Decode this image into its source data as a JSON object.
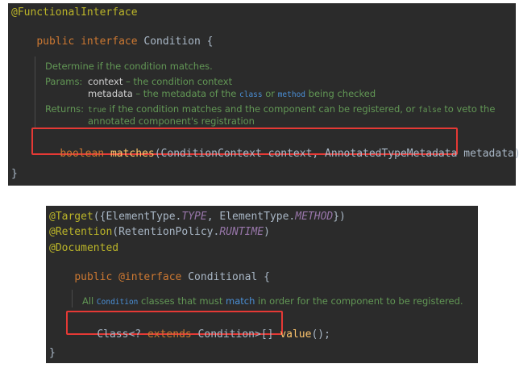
{
  "snippet1": {
    "annotation": "@FunctionalInterface",
    "decl": {
      "kw_public": "public",
      "kw_interface": "interface",
      "name": "Condition",
      "open_brace": "{"
    },
    "doc": {
      "summary": "Determine if the condition matches.",
      "params_label": "Params:",
      "param1_name": "context",
      "param1_desc": " – the condition context",
      "param2_name": "metadata",
      "param2_desc_pre": " – the metadata of the ",
      "param2_code1": "class",
      "param2_mid": " or ",
      "param2_code2": "method",
      "param2_post": " being checked",
      "returns_label": "Returns:",
      "returns_code1": "true",
      "returns_text1": " if the condition matches and the component can be registered, or ",
      "returns_code2": "false",
      "returns_text2": " to veto the",
      "returns_line2": "annotated component's registration"
    },
    "method": {
      "return_type": "boolean",
      "name": "matches",
      "params": "(ConditionContext context, AnnotatedTypeMetadata metadata);"
    },
    "close_brace": "}"
  },
  "snippet2": {
    "target": {
      "ann": "@Target",
      "open": "({ElementType.",
      "type_const": "TYPE",
      "sep": ", ElementType.",
      "method_const": "METHOD",
      "close": "})"
    },
    "retention": {
      "ann": "@Retention",
      "open": "(RetentionPolicy.",
      "const": "RUNTIME",
      "close": ")"
    },
    "documented": "@Documented",
    "decl": {
      "kw_public": "public",
      "kw_interface": "@interface",
      "name": "Conditional",
      "open_brace": "{"
    },
    "doc": {
      "pre": "All ",
      "code": "Condition",
      "mid": " classes that must ",
      "link": "match",
      "post": " in order for the component to be registered."
    },
    "method": {
      "type_pre": "Class<? ",
      "kw_extends": "extends",
      "type_post": " Condition>[] ",
      "name": "value",
      "end": "();"
    },
    "close_brace": "}"
  },
  "colors": {
    "editor_bg": "#2b2b2b",
    "keyword": "#cc7832",
    "annotation": "#bbb529",
    "method": "#ffc66d",
    "constant": "#9876aa",
    "doc_text": "#629755",
    "highlight_border": "#e53935"
  }
}
